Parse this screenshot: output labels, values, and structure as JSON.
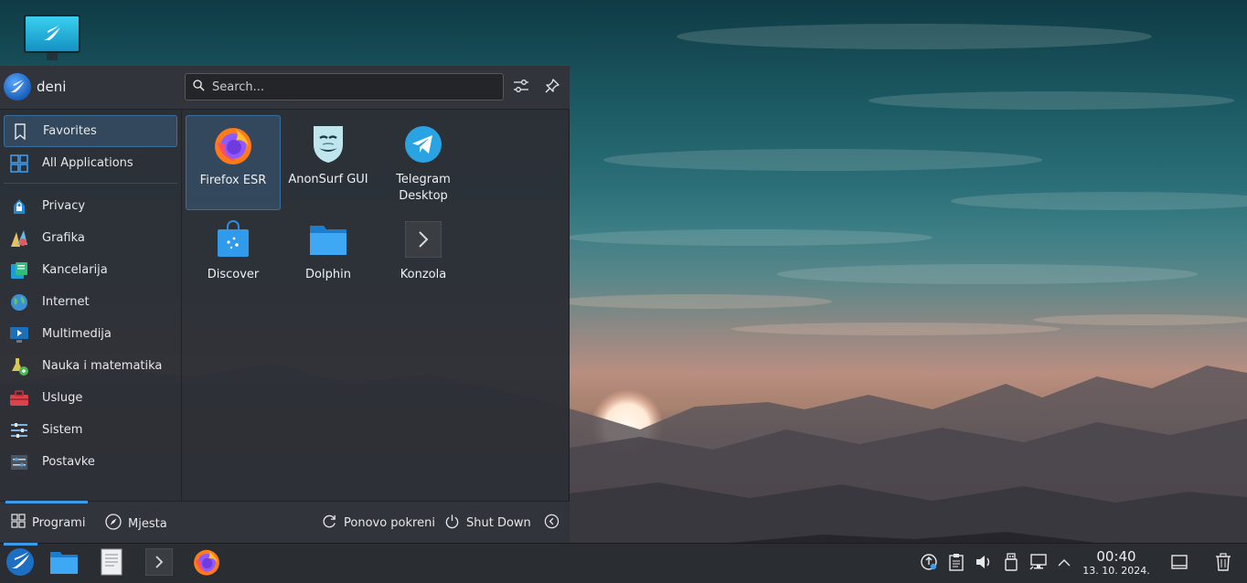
{
  "launcher": {
    "user_name": "deni",
    "search_placeholder": "Search...",
    "sidebar": [
      {
        "label": "Favorites",
        "icon": "bookmark-icon",
        "active": true
      },
      {
        "label": "All Applications",
        "icon": "grid-apps-icon"
      },
      {
        "label": "Privacy",
        "icon": "privacy-lock-icon"
      },
      {
        "label": "Grafika",
        "icon": "graphics-icon"
      },
      {
        "label": "Kancelarija",
        "icon": "office-icon"
      },
      {
        "label": "Internet",
        "icon": "globe-icon"
      },
      {
        "label": "Multimedija",
        "icon": "multimedia-icon"
      },
      {
        "label": "Nauka i matematika",
        "icon": "science-icon"
      },
      {
        "label": "Usluge",
        "icon": "toolbox-icon"
      },
      {
        "label": "Sistem",
        "icon": "system-icon"
      },
      {
        "label": "Postavke",
        "icon": "settings-icon"
      }
    ],
    "apps": [
      {
        "label": "Firefox ESR",
        "icon": "firefox-icon",
        "active": true
      },
      {
        "label": "AnonSurf GUI",
        "icon": "anonsurf-mask-icon"
      },
      {
        "label": "Telegram Desktop",
        "icon": "telegram-icon"
      },
      {
        "label": "Discover",
        "icon": "discover-bag-icon"
      },
      {
        "label": "Dolphin",
        "icon": "folder-icon"
      },
      {
        "label": "Konzola",
        "icon": "terminal-icon"
      }
    ],
    "footer": {
      "programs": "Programi",
      "places": "Mjesta",
      "restart": "Ponovo pokreni",
      "shutdown": "Shut Down"
    }
  },
  "taskbar": {
    "items": [
      "launcher-icon",
      "dolphin-icon",
      "text-editor-icon",
      "terminal-icon",
      "firefox-icon"
    ],
    "tray": [
      "update-notifier-icon",
      "clipboard-icon",
      "volume-icon",
      "usb-device-icon",
      "network-icon",
      "expand-arrow-icon"
    ],
    "time": "00:40",
    "date": "13. 10. 2024."
  },
  "colors": {
    "accent": "#3d9be9",
    "panel": "#2c2f35",
    "selection": "#3d658c"
  }
}
